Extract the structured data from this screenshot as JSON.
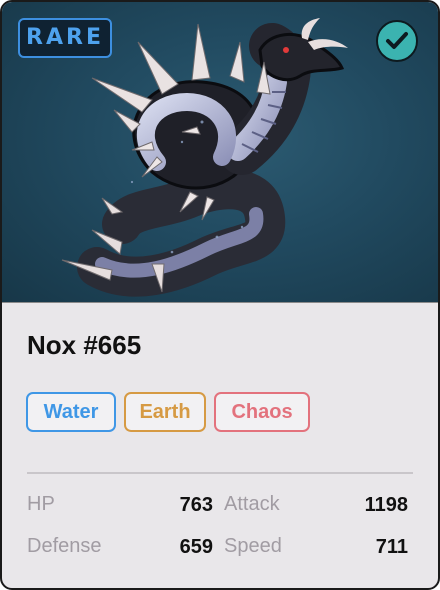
{
  "card": {
    "rarity": "RARE",
    "name": "Nox #665",
    "verified_icon": "checkmark-icon",
    "artwork": "dark-serpent-dragon-illustration",
    "tags": [
      {
        "label": "Water",
        "color": "#3f97e6"
      },
      {
        "label": "Earth",
        "color": "#d69a43"
      },
      {
        "label": "Chaos",
        "color": "#e3727d"
      }
    ],
    "stats": {
      "hp": {
        "label": "HP",
        "value": "763"
      },
      "attack": {
        "label": "Attack",
        "value": "1198"
      },
      "defense": {
        "label": "Defense",
        "value": "659"
      },
      "speed": {
        "label": "Speed",
        "value": "711"
      }
    }
  },
  "colors": {
    "rarity_accent": "#4ea2ee",
    "verified_badge": "#3bb3b0",
    "art_background": "#214a60",
    "card_background": "#e9e7ea"
  }
}
